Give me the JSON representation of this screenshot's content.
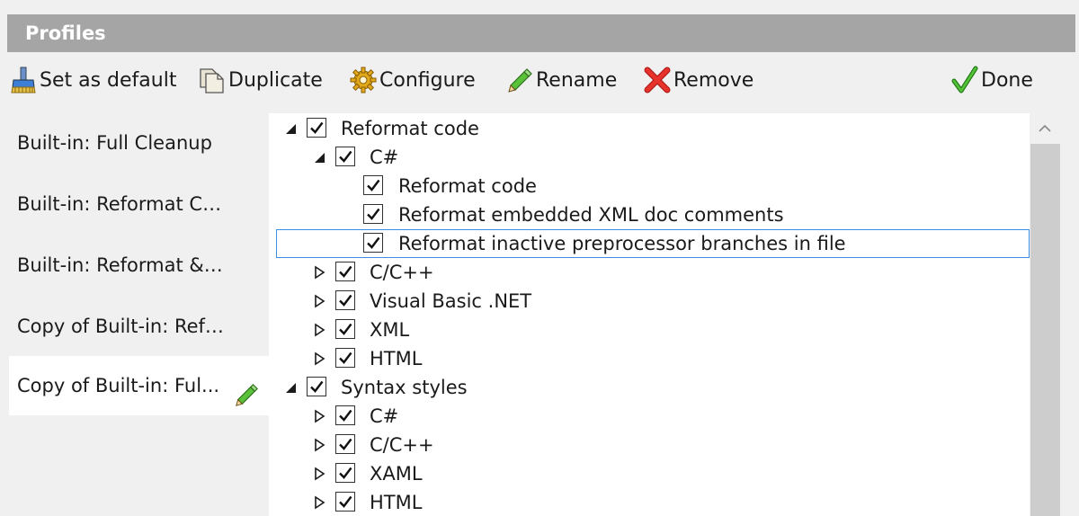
{
  "header": {
    "title": "Profiles"
  },
  "toolbar": {
    "set_default": "Set as default",
    "duplicate": "Duplicate",
    "configure": "Configure",
    "rename": "Rename",
    "remove": "Remove",
    "done": "Done"
  },
  "profiles": [
    {
      "label": "Built-in: Full Cleanup"
    },
    {
      "label": "Built-in: Reformat Code"
    },
    {
      "label": "Built-in: Reformat & Ap..."
    },
    {
      "label": "Copy of Built-in: Reform..."
    },
    {
      "label": "Copy of Built-in: Ful...",
      "selected": true
    }
  ],
  "tree": [
    {
      "label": "Reformat code",
      "level": 0,
      "expander": "expanded",
      "checked": true
    },
    {
      "label": "C#",
      "level": 1,
      "expander": "expanded",
      "checked": true
    },
    {
      "label": "Reformat code",
      "level": 2,
      "expander": "none",
      "checked": true
    },
    {
      "label": "Reformat embedded XML doc comments",
      "level": 2,
      "expander": "none",
      "checked": true
    },
    {
      "label": "Reformat inactive preprocessor branches in file",
      "level": 2,
      "expander": "none",
      "checked": true,
      "focused": true
    },
    {
      "label": "C/C++",
      "level": 1,
      "expander": "collapsed",
      "checked": true
    },
    {
      "label": "Visual Basic .NET",
      "level": 1,
      "expander": "collapsed",
      "checked": true
    },
    {
      "label": "XML",
      "level": 1,
      "expander": "collapsed",
      "checked": true
    },
    {
      "label": "HTML",
      "level": 1,
      "expander": "collapsed",
      "checked": true
    },
    {
      "label": "Syntax styles",
      "level": 0,
      "expander": "expanded",
      "checked": true
    },
    {
      "label": "C#",
      "level": 1,
      "expander": "collapsed",
      "checked": true
    },
    {
      "label": "C/C++",
      "level": 1,
      "expander": "collapsed",
      "checked": true
    },
    {
      "label": "XAML",
      "level": 1,
      "expander": "collapsed",
      "checked": true
    },
    {
      "label": "HTML",
      "level": 1,
      "expander": "collapsed",
      "checked": true
    }
  ],
  "colors": {
    "header_bg": "#a5a5a5",
    "focus_border": "#3c8fe0",
    "remove_red": "#e8322c",
    "done_green": "#3fae2a"
  }
}
